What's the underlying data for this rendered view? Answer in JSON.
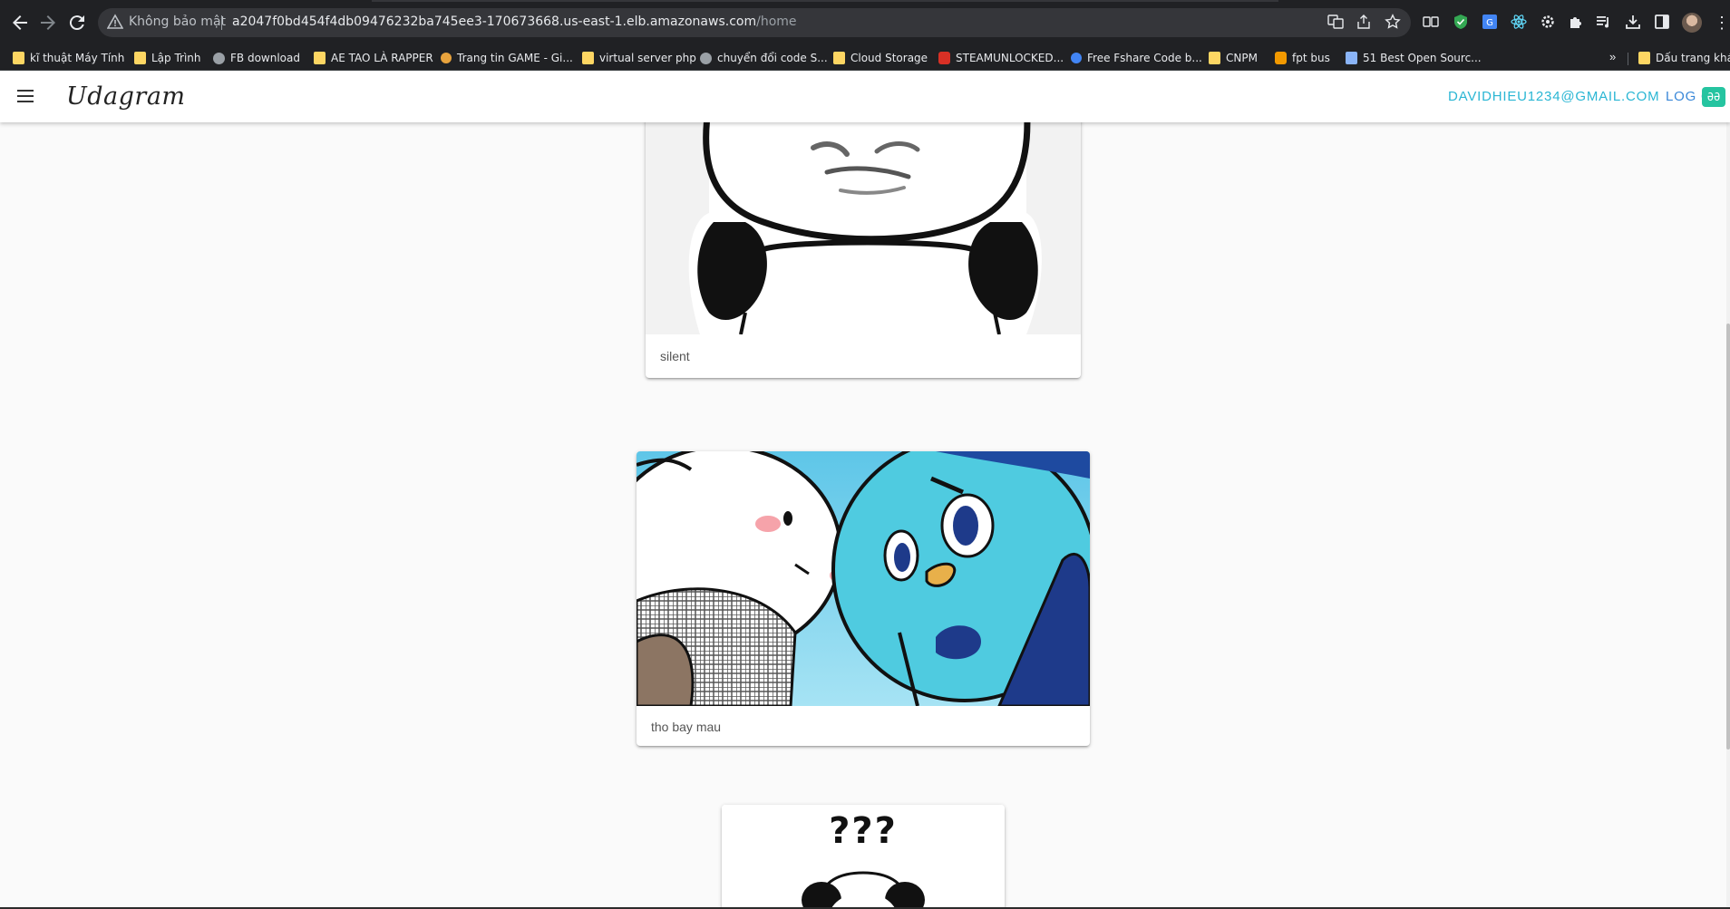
{
  "browser": {
    "security_label": "Không bảo mật",
    "url_host": "a2047f0bd454f4db09476232ba745ee3-170673668.us-east-1.elb.amazonaws.com",
    "url_path": "/home",
    "overflow_label": "»",
    "other_bookmarks_label": "Dấu trang khác"
  },
  "bookmarks": [
    {
      "label": "kĩ thuật Máy Tính",
      "icon": "folder-icon"
    },
    {
      "label": "Lập Trình",
      "icon": "folder-icon"
    },
    {
      "label": "FB download",
      "icon": "globe-icon"
    },
    {
      "label": "AE TAO LÀ RAPPER",
      "icon": "folder-icon"
    },
    {
      "label": "Trang tin GAME - Gi...",
      "icon": "game-icon"
    },
    {
      "label": "virtual server php",
      "icon": "folder-icon"
    },
    {
      "label": "chuyển đổi code S...",
      "icon": "globe-icon"
    },
    {
      "label": "Cloud Storage",
      "icon": "folder-icon"
    },
    {
      "label": "STEAMUNLOCKED...",
      "icon": "steam-icon"
    },
    {
      "label": "Free Fshare Code b...",
      "icon": "j-icon"
    },
    {
      "label": "CNPM",
      "icon": "folder-icon"
    },
    {
      "label": "fpt bus",
      "icon": "bus-icon"
    },
    {
      "label": "51 Best Open Sourc...",
      "icon": "doc-icon"
    }
  ],
  "app": {
    "brand": "Udagram",
    "user_email": "DAVIDHIEU1234@GMAIL.COM",
    "logout_label": "LOG O",
    "translate_badge": "ƏƏ"
  },
  "feed": [
    {
      "caption": "silent",
      "image": "panda-meme-bottom"
    },
    {
      "caption": "tho bay mau",
      "image": "bunny-and-bird-cartoon"
    },
    {
      "caption": "",
      "image": "panda-question-meme",
      "overlay_text": "???"
    }
  ]
}
